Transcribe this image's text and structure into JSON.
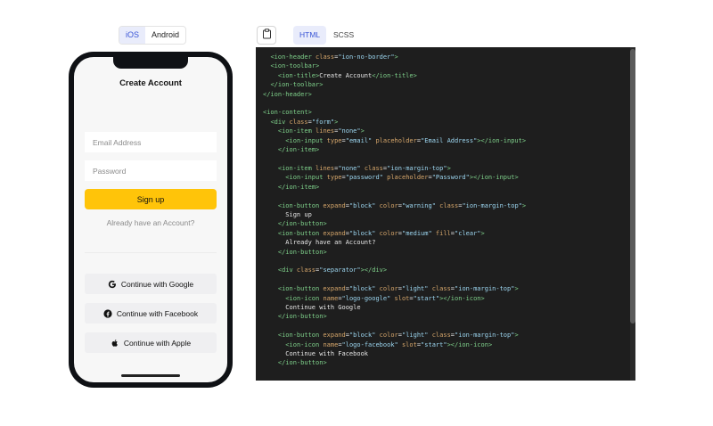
{
  "platform_toggle": {
    "options": [
      "iOS",
      "Android"
    ],
    "selected": "iOS"
  },
  "phone": {
    "title": "Create Account",
    "email_placeholder": "Email Address",
    "password_placeholder": "Password",
    "signup_label": "Sign up",
    "login_link": "Already have an Account?",
    "google_label": "Continue with Google",
    "facebook_label": "Continue with Facebook",
    "apple_label": "Continue with Apple",
    "colors": {
      "warning": "#ffc409",
      "light": "#efeff1",
      "frame": "#0f1115"
    },
    "icons": [
      "logo-google",
      "logo-facebook",
      "logo-apple"
    ]
  },
  "code_panel": {
    "copy_icon": "clipboard-icon",
    "tabs": [
      "HTML",
      "SCSS"
    ],
    "active_tab": "HTML",
    "lines": [
      "  <ion-header class=\"ion-no-border\">",
      "  <ion-toolbar>",
      "    <ion-title>Create Account</ion-title>",
      "  </ion-toolbar>",
      "</ion-header>",
      "",
      "<ion-content>",
      "  <div class=\"form\">",
      "    <ion-item lines=\"none\">",
      "      <ion-input type=\"email\" placeholder=\"Email Address\"></ion-input>",
      "    </ion-item>",
      "",
      "    <ion-item lines=\"none\" class=\"ion-margin-top\">",
      "      <ion-input type=\"password\" placeholder=\"Password\"></ion-input>",
      "    </ion-item>",
      "",
      "    <ion-button expand=\"block\" color=\"warning\" class=\"ion-margin-top\">",
      "      Sign up",
      "    </ion-button>",
      "    <ion-button expand=\"block\" color=\"medium\" fill=\"clear\">",
      "      Already have an Account?",
      "    </ion-button>",
      "",
      "    <div class=\"separator\"></div>",
      "",
      "    <ion-button expand=\"block\" color=\"light\" class=\"ion-margin-top\">",
      "      <ion-icon name=\"logo-google\" slot=\"start\"></ion-icon>",
      "      Continue with Google",
      "    </ion-button>",
      "",
      "    <ion-button expand=\"block\" color=\"light\" class=\"ion-margin-top\">",
      "      <ion-icon name=\"logo-facebook\" slot=\"start\"></ion-icon>",
      "      Continue with Facebook",
      "    </ion-button>"
    ]
  }
}
